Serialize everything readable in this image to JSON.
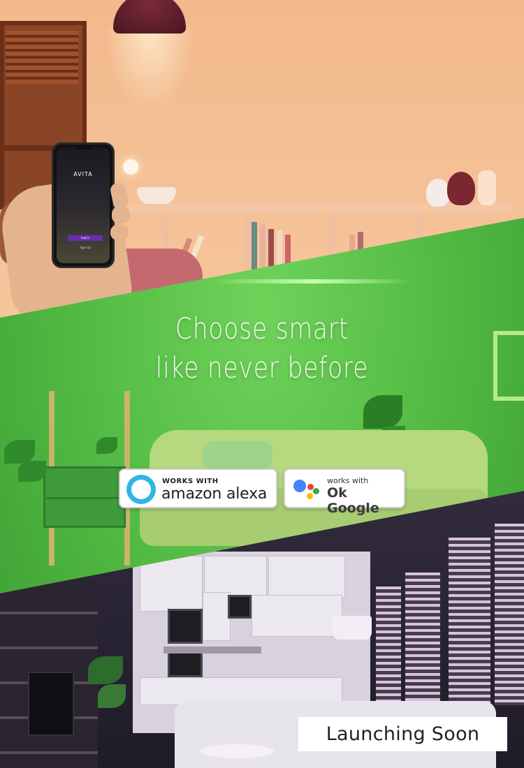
{
  "phone": {
    "brand": "AVITA",
    "login_label": "Log in",
    "signup_label": "Sign Up"
  },
  "headline": {
    "line1": "Choose smart",
    "line2": "like never before"
  },
  "badges": {
    "alexa": {
      "small": "WORKS WITH",
      "big": "amazon alexa",
      "icon": "alexa-ring-icon"
    },
    "google": {
      "small": "works with",
      "big": "Ok Google",
      "icon": "google-assistant-dots-icon"
    }
  },
  "footer": {
    "launch_label": "Launching Soon"
  },
  "colors": {
    "top_wall": "#f2b98c",
    "middle_wall": "#4fb740",
    "bottom_room": "#2e2a3a",
    "alexa_blue": "#2fb6e6",
    "google_blue": "#4285f4",
    "google_red": "#ea4335",
    "google_yellow": "#fbbc05",
    "google_green": "#34a853"
  }
}
